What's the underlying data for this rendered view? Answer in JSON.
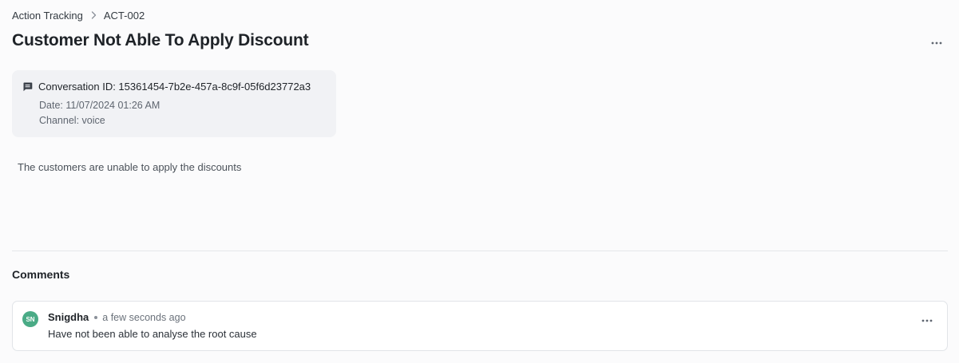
{
  "breadcrumb": {
    "parent": "Action Tracking",
    "separator_icon": "chevron-right-icon",
    "current": "ACT-002"
  },
  "header": {
    "title": "Customer Not Able To Apply Discount",
    "more_icon": "more-horizontal-icon"
  },
  "conversation": {
    "icon": "chat-icon",
    "id_text": "Conversation ID: 15361454-7b2e-457a-8c9f-05f6d23772a3",
    "date_text": "Date: 11/07/2024 01:26 AM",
    "channel_text": "Channel: voice"
  },
  "description": "The customers are unable to apply the discounts",
  "comments": {
    "heading": "Comments",
    "items": [
      {
        "avatar_initials": "SN",
        "avatar_color": "#4aab86",
        "author": "Snigdha",
        "time": "a few seconds ago",
        "text": "Have not been able to analyse the root cause"
      }
    ]
  },
  "colors": {
    "background": "#fbfbfc",
    "card_background": "#f1f2f5",
    "text_primary": "#1f2328",
    "text_secondary": "#5f6670"
  }
}
